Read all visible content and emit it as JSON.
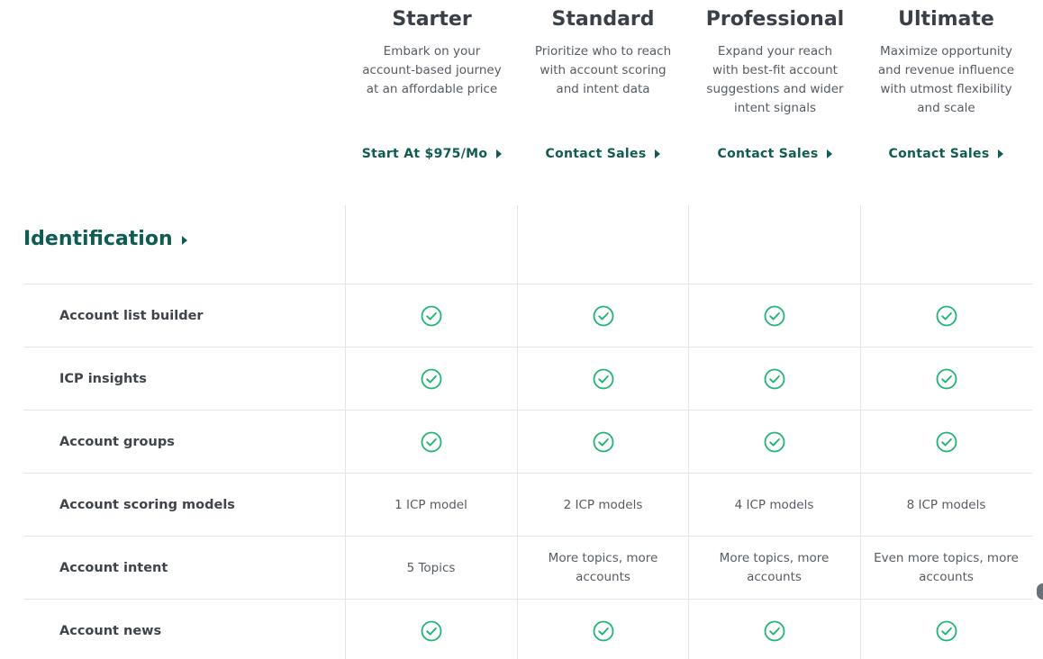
{
  "plans": [
    {
      "name": "Starter",
      "desc": "Embark on your account-based journey at an affordable price",
      "cta": "Start At $975/Mo"
    },
    {
      "name": "Standard",
      "desc": "Prioritize who to reach with account scoring and intent data",
      "cta": "Contact Sales"
    },
    {
      "name": "Professional",
      "desc": "Expand your reach with best-fit account suggestions and wider intent signals",
      "cta": "Contact Sales"
    },
    {
      "name": "Ultimate",
      "desc": "Maximize opportunity and revenue influence with utmost flexibility and scale",
      "cta": "Contact Sales"
    }
  ],
  "section": {
    "title": "Identification"
  },
  "rows": [
    {
      "label": "Account list builder",
      "cells": [
        "check",
        "check",
        "check",
        "check"
      ]
    },
    {
      "label": "ICP insights",
      "cells": [
        "check",
        "check",
        "check",
        "check"
      ]
    },
    {
      "label": "Account groups",
      "cells": [
        "check",
        "check",
        "check",
        "check"
      ]
    },
    {
      "label": "Account scoring models",
      "cells": [
        "1 ICP model",
        "2 ICP models",
        "4 ICP models",
        "8 ICP models"
      ]
    },
    {
      "label": "Account intent",
      "cells": [
        "5 Topics",
        "More topics, more accounts",
        "More topics, more accounts",
        "Even more topics, more accounts"
      ]
    },
    {
      "label": "Account news",
      "cells": [
        "check",
        "check",
        "check",
        "check"
      ]
    }
  ],
  "colors": {
    "brand": "#0f5c52",
    "check": "#21b573",
    "grid": "#e3e5e8"
  },
  "icons": {
    "check": "check-circle-icon",
    "cta": "caret-right-icon"
  }
}
